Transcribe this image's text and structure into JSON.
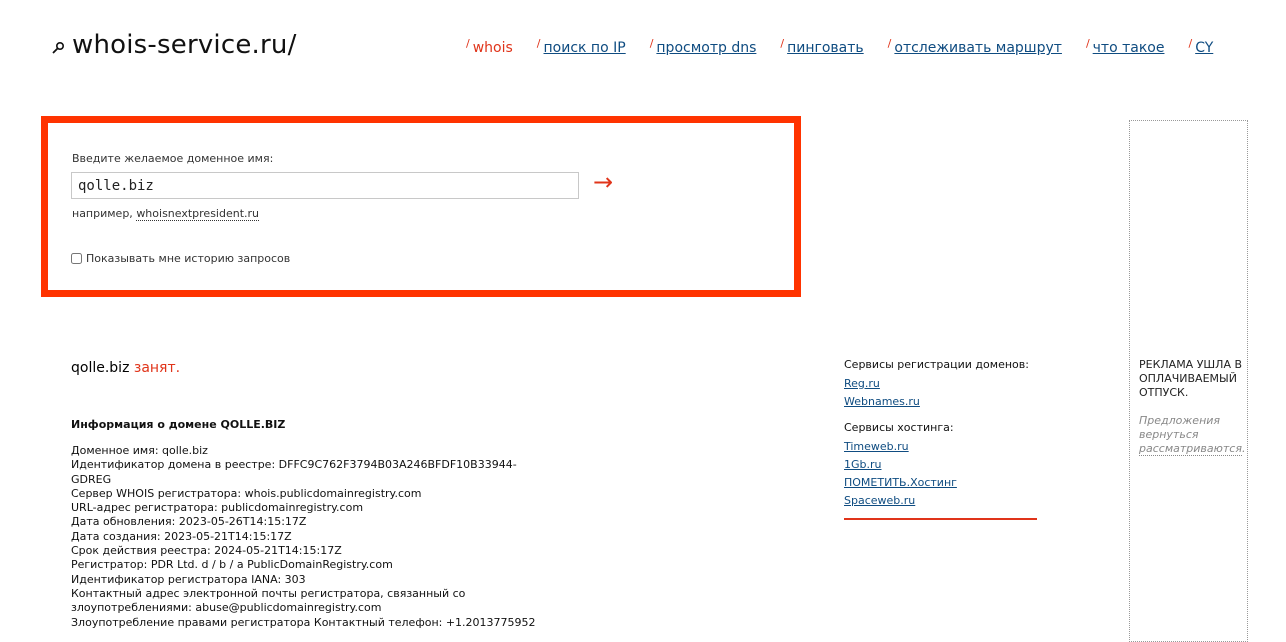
{
  "header": {
    "logo": "whois-service.ru/",
    "nav": [
      {
        "label": "whois",
        "active": true
      },
      {
        "label": "поиск по IP",
        "active": false
      },
      {
        "label": "просмотр dns",
        "active": false
      },
      {
        "label": "пинговать",
        "active": false
      },
      {
        "label": "отслеживать маршрут",
        "active": false
      },
      {
        "label": "что такое",
        "active": false
      },
      {
        "label": "CY",
        "active": false
      }
    ]
  },
  "search": {
    "label": "Введите желаемое доменное имя:",
    "value": "qolle.biz",
    "go_arrow": "→",
    "example_prefix": "например,",
    "example_link": "whoisnextpresident.ru",
    "history_label": "Показывать мне историю запросов"
  },
  "result": {
    "domain": "qolle.biz",
    "status": "занят.",
    "info_title": "Информация о домене QOLLE.BIZ",
    "lines": [
      "Доменное имя: qolle.biz",
      "Идентификатор домена в реестре: DFFC9C762F3794B03A246BFDF10B33944-GDREG",
      "Сервер WHOIS регистратора: whois.publicdomainregistry.com",
      "URL-адрес регистратора: publicdomainregistry.com",
      "Дата обновления: 2023-05-26T14:15:17Z",
      "Дата создания: 2023-05-21T14:15:17Z",
      "Срок действия реестра: 2024-05-21T14:15:17Z",
      "Регистратор: PDR Ltd. d / b / a PublicDomainRegistry.com",
      "Идентификатор регистратора IANA: 303",
      "Контактный адрес электронной почты регистратора, связанный со злоупотреблениями: abuse@publicdomainregistry.com",
      "Злоупотребление правами регистратора Контактный телефон: +1.2013775952"
    ]
  },
  "services": {
    "registration_head": "Сервисы регистрации доменов:",
    "registration": [
      "Reg.ru",
      "Webnames.ru"
    ],
    "hosting_head": "Сервисы хостинга:",
    "hosting": [
      "Timeweb.ru",
      "1Gb.ru",
      "ПОМЕТИТЬ.Хостинг",
      "Spaceweb.ru"
    ]
  },
  "ad": {
    "title": "РЕКЛАМА УШЛА В ОПЛАЧИВАЕМЫЙ ОТПУСК.",
    "sub_text": "Предложения вернуться",
    "sub_link": "рассматриваются",
    "sub_end": "."
  },
  "colors": {
    "accent": "#ff3300",
    "link": "#0f4c81"
  }
}
